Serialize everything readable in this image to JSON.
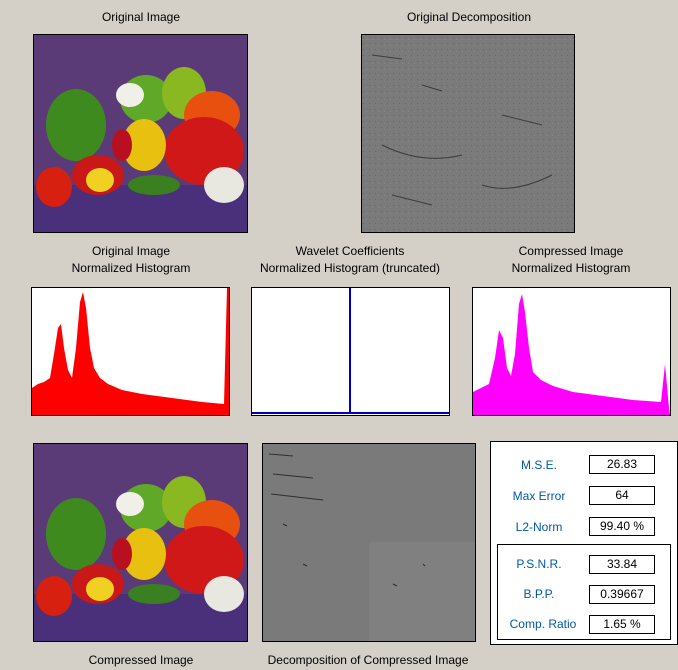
{
  "labels": {
    "original_image": "Original Image",
    "original_decomposition": "Original Decomposition",
    "hist_original": [
      "Original Image",
      "Normalized Histogram"
    ],
    "hist_wavelet": [
      "Wavelet Coefficients",
      "Normalized Histogram (truncated)"
    ],
    "hist_compressed": [
      "Compressed Image",
      "Normalized Histogram"
    ],
    "compressed_image": "Compressed Image",
    "decomposition_compressed": "Decomposition of Compressed Image"
  },
  "stats": [
    {
      "label": "M.S.E.",
      "value": "26.83"
    },
    {
      "label": "Max Error",
      "value": "64"
    },
    {
      "label": "L2-Norm",
      "value": "99.40 %"
    }
  ],
  "stats_boxed": [
    {
      "label": "P.S.N.R.",
      "value": "33.84"
    },
    {
      "label": "B.P.P.",
      "value": "0.39667"
    },
    {
      "label": "Comp. Ratio",
      "value": "1.65 %"
    }
  ],
  "colors": {
    "hist_original": "#ff0000",
    "hist_wavelet": "#0000c8",
    "hist_compressed": "#ff00ff",
    "stat_label": "#0058a8"
  }
}
